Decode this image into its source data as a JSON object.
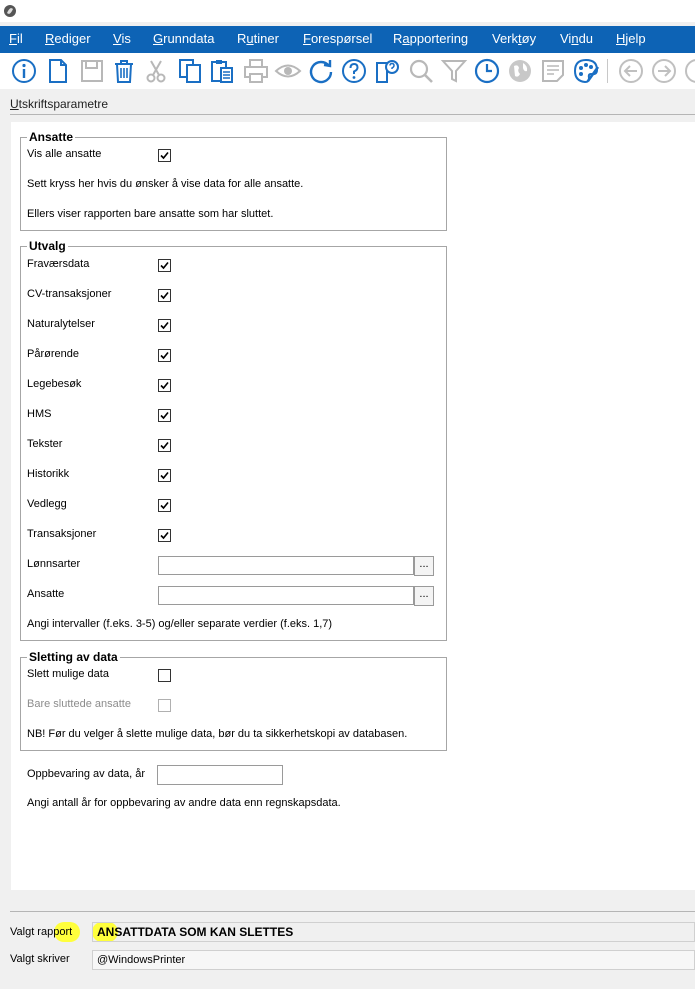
{
  "menu": [
    "Fil",
    "Rediger",
    "Vis",
    "Grunndata",
    "Rutiner",
    "Forespørsel",
    "Rapportering",
    "Verktøy",
    "Vindu",
    "Hjelp"
  ],
  "toolbar_icons": [
    "info-icon",
    "new-document-icon",
    "save-icon",
    "delete-icon",
    "cut-icon",
    "copy-icon",
    "paste-icon",
    "print-icon",
    "preview-icon",
    "refresh-icon",
    "help-icon",
    "query-icon",
    "search-icon",
    "filter-icon",
    "history-icon",
    "globe-icon",
    "note-icon",
    "palette-icon",
    "back-icon",
    "forward-icon",
    "next-icon"
  ],
  "section_title": "Utskriftsparametre",
  "ansatte": {
    "legend": "Ansatte",
    "vis_alle_label": "Vis alle ansatte",
    "vis_alle_checked": true,
    "help1": "Sett kryss her hvis du ønsker å vise data for alle ansatte.",
    "help2": "Ellers viser rapporten bare ansatte som har sluttet."
  },
  "utvalg": {
    "legend": "Utvalg",
    "items": [
      {
        "label": "Fraværsdata",
        "checked": true
      },
      {
        "label": "CV-transaksjoner",
        "checked": true
      },
      {
        "label": "Naturalytelser",
        "checked": true
      },
      {
        "label": "Pårørende",
        "checked": true
      },
      {
        "label": "Legebesøk",
        "checked": true
      },
      {
        "label": "HMS",
        "checked": true
      },
      {
        "label": "Tekster",
        "checked": true
      },
      {
        "label": "Historikk",
        "checked": true
      },
      {
        "label": "Vedlegg",
        "checked": true
      },
      {
        "label": "Transaksjoner",
        "checked": true
      }
    ],
    "lonnsarter_label": "Lønnsarter",
    "lonnsarter_value": "",
    "ansatte_label": "Ansatte",
    "ansatte_value": "",
    "ellipsis": "...",
    "help": "Angi intervaller (f.eks. 3-5) og/eller separate verdier (f.eks. 1,7)"
  },
  "sletting": {
    "legend": "Sletting av data",
    "slett_label": "Slett mulige data",
    "slett_checked": false,
    "bare_label": "Bare sluttede ansatte",
    "bare_checked": false,
    "help": "NB! Før du velger å slette mulige data, bør du ta sikkerhetskopi av databasen."
  },
  "oppbevaring": {
    "label": "Oppbevaring av data, år",
    "value": "",
    "help": "Angi antall år for oppbevaring av andre data enn regnskapsdata."
  },
  "footer": {
    "rapport_label": "Valgt rapport",
    "rapport_value": "ANSATTDATA SOM KAN SLETTES",
    "skriver_label": "Valgt skriver",
    "skriver_value": "@WindowsPrinter"
  },
  "colors": {
    "menubar": "#0d63b5",
    "icon_blue": "#1a6fc4",
    "highlight": "#ffff3c"
  }
}
